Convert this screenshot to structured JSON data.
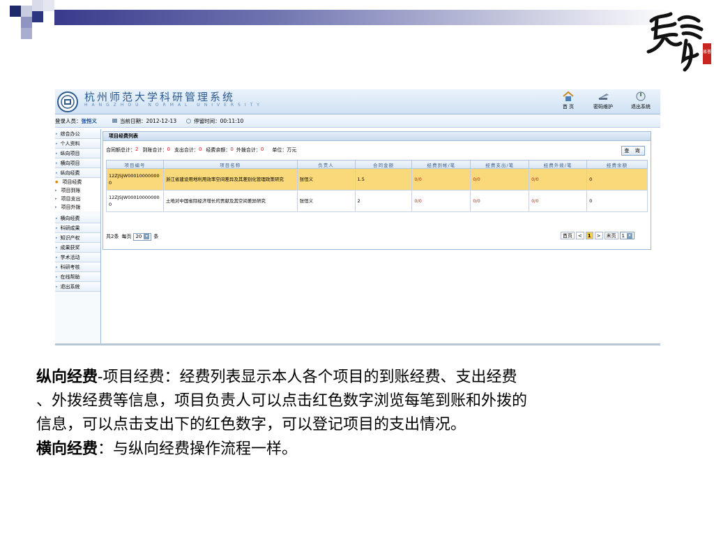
{
  "slide": {
    "logo_text": "易普"
  },
  "system": {
    "title": "杭州师范大学科研管理系统",
    "subtitle": "HANGZHOU NORMAL UNIVERSITY",
    "nav": [
      {
        "label": "首 页",
        "icon": "home-icon"
      },
      {
        "label": "密码维护",
        "icon": "password-icon"
      },
      {
        "label": "退出系统",
        "icon": "exit-icon"
      }
    ]
  },
  "infobar": {
    "login_label": "登录人员：",
    "login_user": "张恒义",
    "date_label": "当前日期：",
    "date_value": "2012-12-13",
    "stay_label": "停留时间：",
    "stay_value": "00:11:10"
  },
  "sidebar": {
    "items_top": [
      "综合办公",
      "个人资料",
      "纵向项目",
      "横向项目",
      "纵向经费"
    ],
    "sub_items": [
      "项目经费",
      "项目到账",
      "项目支出",
      "项目外拨"
    ],
    "items_bottom": [
      "横向经费",
      "科研成果",
      "知识产权",
      "成果获奖",
      "学术活动",
      "科研考核",
      "在线帮助",
      "退出系统"
    ]
  },
  "panel": {
    "title": "项目经费列表",
    "summary": {
      "contract_label": "合同额总计：",
      "contract_value": "2",
      "arrive_label": "到账合计：",
      "arrive_value": "0",
      "spend_label": "支出合计：",
      "spend_value": "0",
      "balance_label": "经费余额：",
      "balance_value": "0",
      "out_label": "外拨合计：",
      "out_value": "0",
      "unit_label": "单位：万元"
    },
    "query_button": "查 询",
    "columns": [
      "项目编号",
      "项目名称",
      "负责人",
      "合同金额",
      "经费到帐/笔",
      "经费支出/笔",
      "经费外拨/笔",
      "经费余额"
    ],
    "rows": [
      {
        "id": "12ZJSJW000100000000",
        "name": "浙江省建设用地利用效率空间差异及其差别化管理政策研究",
        "leader": "张恒义",
        "amount": "1.5",
        "arrive": "0/0",
        "spend": "0/0",
        "out": "0/0",
        "balance": "0",
        "highlight": true
      },
      {
        "id": "12ZJSJW000100000000",
        "name": "土地对中国省际经济增长的贡献及其空间差异研究",
        "leader": "张恒义",
        "amount": "2",
        "arrive": "0/0",
        "spend": "0/0",
        "out": "0/0",
        "balance": "0",
        "highlight": false
      }
    ],
    "pager": {
      "total": "共2条",
      "per_page_label": "每页",
      "per_page_value": "20",
      "unit": "条",
      "first": "首页",
      "prev": "<",
      "current": "1",
      "next": ">",
      "last": "末页",
      "page_select": "1"
    }
  },
  "caption": {
    "line1_bold": "纵向经费",
    "line1_rest": "-项目经费：经费列表显示本人各个项目的到账经费、支出经费",
    "line2": "、外拨经费等信息，项目负责人可以点击红色数字浏览每笔到账和外拨的",
    "line3": "信息，可以点击支出下的红色数字，可以登记项目的支出情况。",
    "line4_bold": "横向经费",
    "line4_rest": "：与纵向经费操作流程一样。"
  }
}
